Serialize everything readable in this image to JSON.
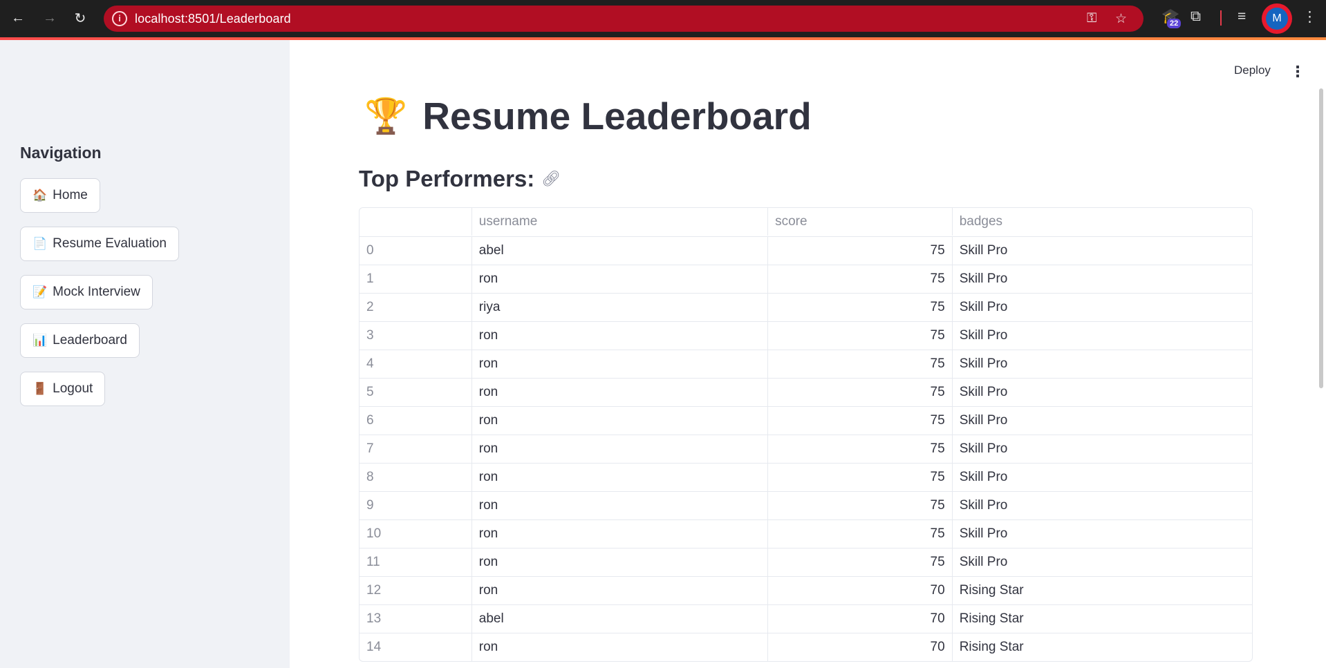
{
  "browser": {
    "url": "localhost:8501/Leaderboard",
    "profile_initial": "M",
    "extension_badge": "22",
    "icons": [
      "back-arrow-icon",
      "forward-arrow-icon",
      "reload-icon",
      "site-info-icon",
      "key-icon",
      "star-icon",
      "graduation-cap-icon",
      "puzzle-icon",
      "media-queue-icon",
      "kebab-icon"
    ]
  },
  "sidebar": {
    "title": "Navigation",
    "items": [
      {
        "emoji": "🏠",
        "label": "Home"
      },
      {
        "emoji": "📄",
        "label": "Resume Evaluation"
      },
      {
        "emoji": "📝",
        "label": "Mock Interview"
      },
      {
        "emoji": "📊",
        "label": "Leaderboard"
      },
      {
        "emoji": "🚪",
        "label": "Logout"
      }
    ]
  },
  "header": {
    "deploy_label": "Deploy",
    "menu_glyph": "⋮"
  },
  "main": {
    "title_emoji": "🏆",
    "title": "Resume Leaderboard",
    "subtitle": "Top Performers:",
    "table": {
      "columns": [
        "",
        "username",
        "score",
        "badges"
      ],
      "rows": [
        [
          "0",
          "abel",
          "75",
          "Skill Pro"
        ],
        [
          "1",
          "ron",
          "75",
          "Skill Pro"
        ],
        [
          "2",
          "riya",
          "75",
          "Skill Pro"
        ],
        [
          "3",
          "ron",
          "75",
          "Skill Pro"
        ],
        [
          "4",
          "ron",
          "75",
          "Skill Pro"
        ],
        [
          "5",
          "ron",
          "75",
          "Skill Pro"
        ],
        [
          "6",
          "ron",
          "75",
          "Skill Pro"
        ],
        [
          "7",
          "ron",
          "75",
          "Skill Pro"
        ],
        [
          "8",
          "ron",
          "75",
          "Skill Pro"
        ],
        [
          "9",
          "ron",
          "75",
          "Skill Pro"
        ],
        [
          "10",
          "ron",
          "75",
          "Skill Pro"
        ],
        [
          "11",
          "ron",
          "75",
          "Skill Pro"
        ],
        [
          "12",
          "ron",
          "70",
          "Rising Star"
        ],
        [
          "13",
          "abel",
          "70",
          "Rising Star"
        ],
        [
          "14",
          "ron",
          "70",
          "Rising Star"
        ]
      ]
    }
  },
  "colors": {
    "urlbar": "#b10e23",
    "sidebar_bg": "#f0f2f6",
    "text": "#31333f",
    "accent": "#ff4b4b"
  }
}
